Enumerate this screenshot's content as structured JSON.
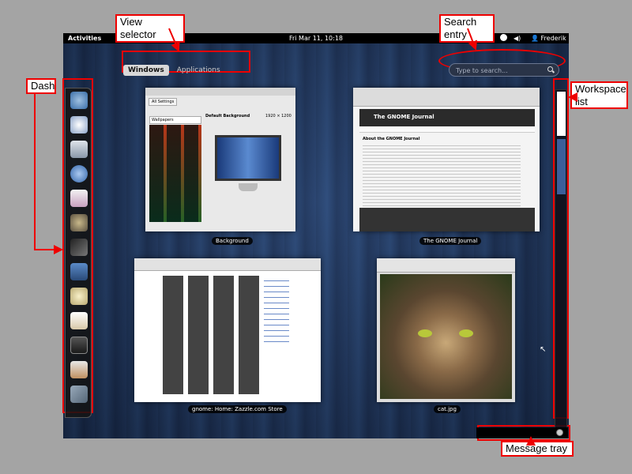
{
  "topbar": {
    "activities": "Activities",
    "clock": "Fri Mar 11, 10:18",
    "user": "Frederik"
  },
  "view_selector": {
    "windows": "Windows",
    "applications": "Applications"
  },
  "search": {
    "placeholder": "Type to search..."
  },
  "windows": [
    {
      "caption": "Background",
      "title": "All Settings",
      "section": "Wallpapers",
      "preview_title": "Default Background",
      "resolution": "1920 × 1200"
    },
    {
      "caption": "The GNOME Journal",
      "heading": "The GNOME Journal",
      "article": "About the GNOME Journal"
    },
    {
      "caption": "gnome: Home: Zazzle.com Store"
    },
    {
      "caption": "cat.jpg"
    }
  ],
  "annotations": {
    "view_selector": "View selector",
    "search_entry": "Search entry",
    "dash": "Dash",
    "workspace_list": "Workspace\nlist",
    "message_tray": "Message tray"
  },
  "dash_icons": [
    "epiphany-browser-icon",
    "evolution-clock-icon",
    "drive-icon",
    "empathy-icon",
    "document-viewer-icon",
    "gimp-icon",
    "inkscape-icon",
    "shotwell-icon",
    "notepad-icon",
    "text-editor-icon",
    "terminal-icon",
    "image-viewer-icon",
    "system-settings-icon"
  ]
}
